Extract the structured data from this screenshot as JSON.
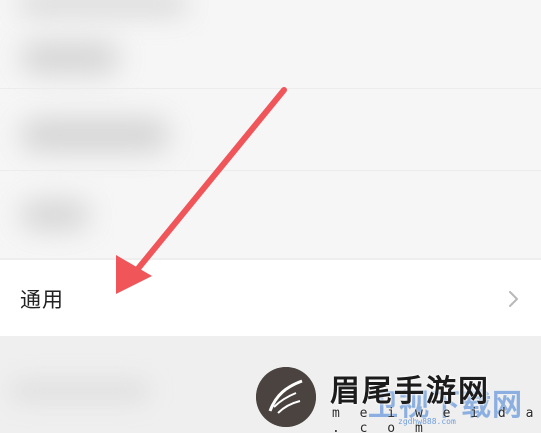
{
  "settings": {
    "general_row": {
      "label": "通用",
      "chevron_icon": "chevron-right-icon"
    }
  },
  "annotation": {
    "arrow_color": "#f0555a"
  },
  "watermark": {
    "title": "眉尾手游网",
    "url": "m e i w e i d a . c o m",
    "overlay_text": "卫视下载网",
    "overlay_url": "zgdhw888.com"
  }
}
